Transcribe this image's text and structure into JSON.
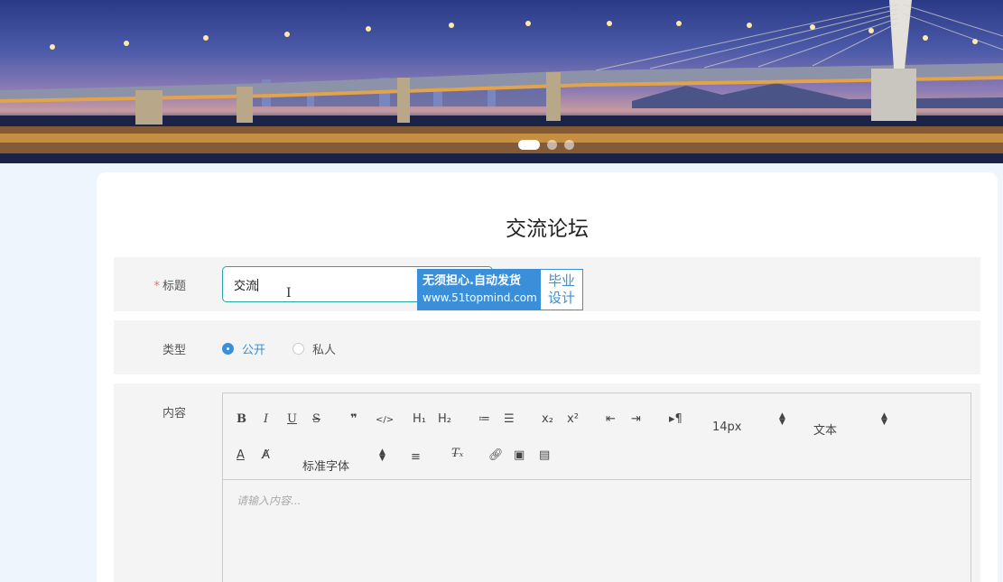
{
  "banner": {
    "carousel_dots": [
      true,
      false,
      false
    ]
  },
  "page_title": "交流论坛",
  "form": {
    "title_label": "标题",
    "title_required_mark": "*",
    "title_value": "交流",
    "type_label": "类型",
    "type_options": [
      {
        "label": "公开",
        "checked": true
      },
      {
        "label": "私人",
        "checked": false
      }
    ],
    "content_label": "内容",
    "content_placeholder": "请输入内容..."
  },
  "editor": {
    "toolbar_row1": {
      "bold": "B",
      "italic": "I",
      "underline": "U",
      "strike": "S",
      "blockquote": "❞",
      "code": "</>",
      "h1": "H₁",
      "h2": "H₂",
      "ordered_list": "≔",
      "bullet_list": "☰",
      "subscript": "x₂",
      "superscript": "x²",
      "outdent": "⇤",
      "indent": "⇥",
      "direction": "▸¶",
      "size_value": "14px",
      "header_value": "文本"
    },
    "toolbar_row2": {
      "font_value": "标准字体"
    }
  },
  "watermark": {
    "line1": "无须担心.自动发货",
    "line2": "www.51topmind.com",
    "right_line1": "毕业",
    "right_line2": "设计"
  },
  "colors": {
    "accent": "#3a8fd8",
    "input_border": "#2aa3a3",
    "required": "#f56c6c",
    "page_bg": "#eef5fc"
  }
}
